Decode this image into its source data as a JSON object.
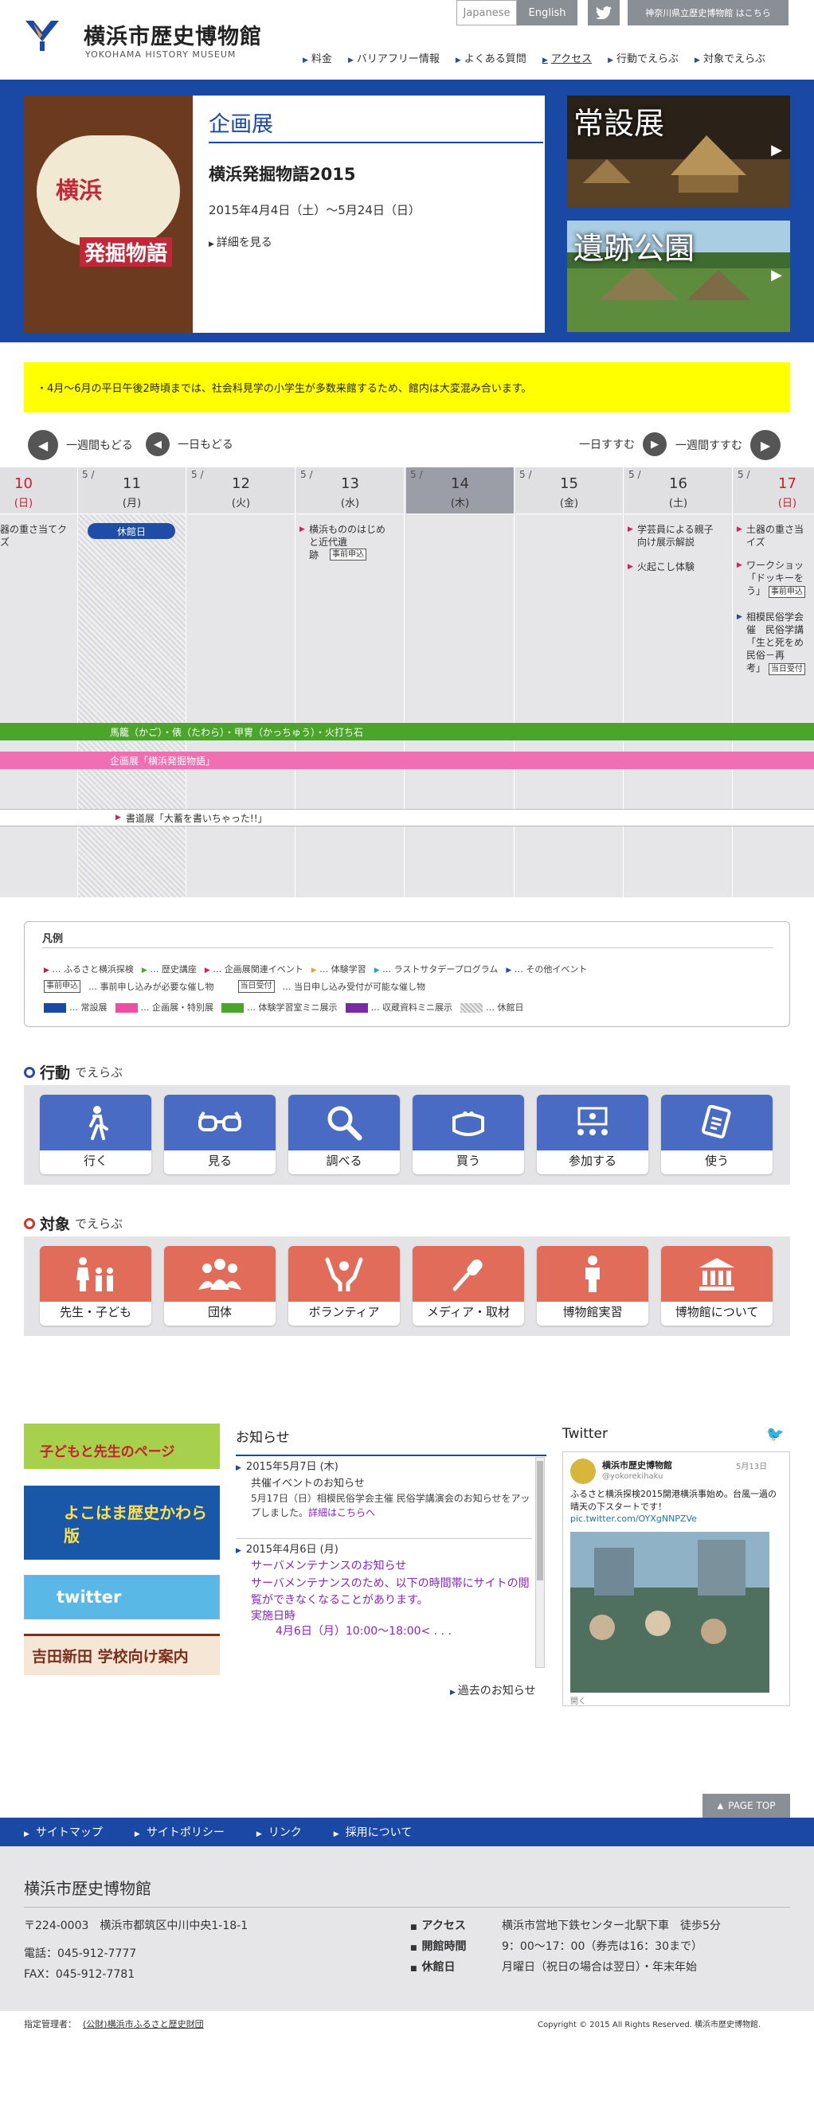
{
  "header": {
    "site_name": "横浜市歴史博物館",
    "site_sub": "YOKOHAMA HISTORY MUSEUM",
    "lang_jp": "Japanese",
    "lang_en": "English",
    "pref_link": "神奈川県立歴史博物館 はこちら",
    "nav": [
      "料金",
      "バリアフリー情報",
      "よくある質問",
      "アクセス",
      "行動でえらぶ",
      "対象でえらぶ"
    ]
  },
  "hero": {
    "poster_title": "横浜",
    "poster_sub": "発掘物語",
    "tag": "企画展",
    "title": "横浜発掘物語2015",
    "date": "2015年4月4日（土）～5月24日（日）",
    "more": "詳細を見る",
    "side1": "常設展",
    "side2": "遺跡公園"
  },
  "notice": "・4月～6月の平日午後2時頃までは、社会科見学の小学生が多数来館するため、館内は大変混み合います。",
  "calnav": {
    "week_prev": "一週間もどる",
    "day_prev": "一日もどる",
    "day_next": "一日すすむ",
    "week_next": "一週間すすむ"
  },
  "calendar": {
    "days": [
      {
        "mo": "",
        "dy": "10",
        "wd": "(日)"
      },
      {
        "mo": "5 /",
        "dy": "11",
        "wd": "(月)"
      },
      {
        "mo": "5 /",
        "dy": "12",
        "wd": "(火)"
      },
      {
        "mo": "5 /",
        "dy": "13",
        "wd": "(水)"
      },
      {
        "mo": "5 /",
        "dy": "14",
        "wd": "(木)"
      },
      {
        "mo": "5 /",
        "dy": "15",
        "wd": "(金)"
      },
      {
        "mo": "5 /",
        "dy": "16",
        "wd": "(土)"
      },
      {
        "mo": "5 /",
        "dy": "17",
        "wd": "(日)"
      }
    ],
    "closed_label": "休館日",
    "ev_sun10": "器の重さ当てク\nズ",
    "ev_wed": "横浜もののはじめ\nと近代遺\n跡",
    "ev_sat1": "学芸員による親子\n向け展示解説",
    "ev_sat2": "火起こし体験",
    "ev_sun17_1": "土器の重さ当\nイズ",
    "ev_sun17_2": "ワークショッ\n「ドッキーを\nう」",
    "ev_sun17_3": "相模民俗学会\n催　民俗学講\n「生と死をめ\n民俗－再\n考」",
    "badge_pre": "事前申込",
    "badge_day": "当日受付",
    "bar_green": "馬籠（かご）・俵（たわら）・甲冑（かっちゅう）・火打ち石",
    "bar_pink": "企画展「横浜発掘物語」",
    "bar_white": "書道展「大蓄を書いちゃった!!」"
  },
  "legend": {
    "title": "凡例",
    "row1": [
      "ふるさと横浜探検",
      "歴史講座",
      "企画展関連イベント",
      "体験学習",
      "ラストサタデープログラム",
      "その他イベント"
    ],
    "pre_badge": "事前申込",
    "pre_text": "… 事前申し込みが必要な催し物",
    "day_badge": "当日受付",
    "day_text": "… 当日申し込み受付が可能な催し物",
    "row3": [
      "常設展",
      "企画展・特別展",
      "体験学習室ミニ展示",
      "収蔵資料ミニ展示",
      "休館日"
    ]
  },
  "action": {
    "h1": "行動",
    "h2": "でえらぶ",
    "items": [
      "行く",
      "見る",
      "調べる",
      "買う",
      "参加する",
      "使う"
    ]
  },
  "target": {
    "h1": "対象",
    "h2": "でえらぶ",
    "items": [
      "先生・子ども",
      "団体",
      "ボランティア",
      "メディア・取材",
      "博物館実習",
      "博物館について"
    ]
  },
  "banners": {
    "b1": "子どもと先生のページ",
    "b2": "よこはま歴史かわら版",
    "b3": "twitter",
    "b4": "吉田新田 学校向け案内"
  },
  "news": {
    "title": "お知らせ",
    "item1_date": "2015年5月7日 (木)",
    "item1_title": "共催イベントのお知らせ",
    "item1_body": "5月17日（日）相模民俗学会主催 民俗学講演会のお知らせをアップしました。",
    "item1_link": "詳細はこちらへ",
    "item2_date": "2015年4月6日 (月)",
    "item2_title": "サーバメンテナンスのお知らせ",
    "item2_body": "サーバメンテナンスのため、以下の時間帯にサイトの閲覧ができなくなることがあります。",
    "item2_sub": "実施日時",
    "item2_time": "4月6日（月）10:00～18:00< . . .",
    "past": "過去のお知らせ"
  },
  "twitter": {
    "title": "Twitter",
    "name": "横浜市歴史博物館",
    "handle": "@yokorekihaku",
    "date": "5月13日",
    "text": "ふるさと横浜探検2015開港横浜事始め。台風一過の晴天の下スタートです！",
    "link": "pic.twitter.com/OYXgNNPZVe",
    "more": "開く"
  },
  "pagetop": "PAGE TOP",
  "footer_nav": [
    "サイトマップ",
    "サイトポリシー",
    "リンク",
    "採用について"
  ],
  "footer": {
    "name": "横浜市歴史博物館",
    "addr": "〒224-0003　横浜市都筑区中川中央1-18-1",
    "tel": "電話：045-912-7777",
    "fax": "FAX：045-912-7781",
    "k1": "アクセス",
    "v1": "横浜市営地下鉄センター北駅下車　徒歩5分",
    "k2": "開館時間",
    "v2": "9：00～17：00（券売は16：30まで）",
    "k3": "休館日",
    "v3": "月曜日（祝日の場合は翌日）・年末年始",
    "mgr_label": "指定管理者：",
    "mgr": "(公財)横浜市ふるさと歴史財団",
    "copy": "Copyright © 2015 All Rights Reserved. 横浜市歴史博物館."
  },
  "colors": {
    "brand_blue": "#1a49a5",
    "notice_yellow": "#ffff00",
    "action_tile": "#4a6bc3",
    "target_tile": "#e06c59",
    "bar_green": "#4ba52b",
    "bar_pink": "#ef6fb2"
  }
}
